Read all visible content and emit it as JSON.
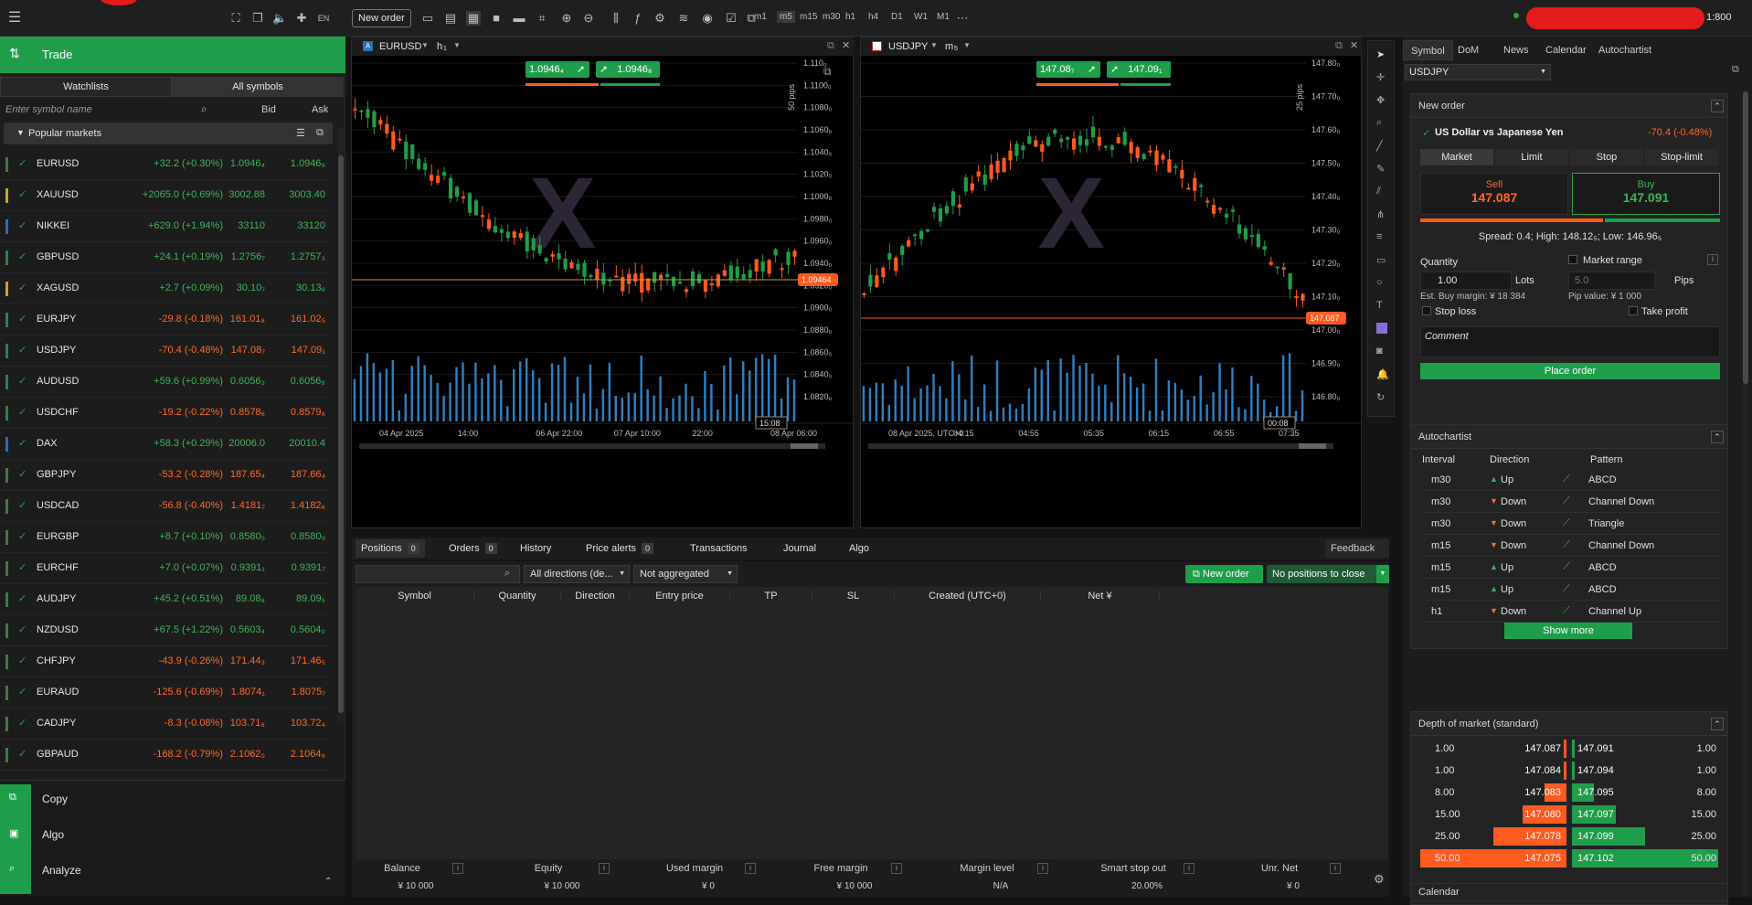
{
  "topbar": {
    "new_order": "New order",
    "timeframes": [
      "m1",
      "m5",
      "m15",
      "m30",
      "h1",
      "h4",
      "D1",
      "W1",
      "M1"
    ],
    "leverage": "1:800"
  },
  "left": {
    "trade_label": "Trade",
    "tabs": [
      "Watchlists",
      "All symbols"
    ],
    "search_placeholder": "Enter symbol name",
    "col_bid": "Bid",
    "col_ask": "Ask",
    "group_label": "Popular markets",
    "rows": [
      {
        "symbol": "EURUSD",
        "change": "+32.2 (+0.30%)",
        "bid": "1.0946₄",
        "ask": "1.0946₈",
        "dir": "up",
        "bar": "#3a7d4a"
      },
      {
        "symbol": "XAUUSD",
        "change": "+2065.0 (+0.69%)",
        "bid": "3002.88",
        "ask": "3003.40",
        "dir": "up",
        "bar": "#c9a227"
      },
      {
        "symbol": "NIKKEI",
        "change": "+629.0 (+1.94%)",
        "bid": "33110",
        "ask": "33120",
        "dir": "up",
        "bar": "#2a6fb6"
      },
      {
        "symbol": "GBPUSD",
        "change": "+24.1 (+0.19%)",
        "bid": "1.2756₇",
        "ask": "1.2757₃",
        "dir": "up",
        "bar": "#3a7d4a"
      },
      {
        "symbol": "XAGUSD",
        "change": "+2.7 (+0.09%)",
        "bid": "30.10₇",
        "ask": "30.13₆",
        "dir": "up",
        "bar": "#c9a227"
      },
      {
        "symbol": "EURJPY",
        "change": "-29.8 (-0.18%)",
        "bid": "161.01₈",
        "ask": "161.02₅",
        "dir": "dn",
        "bar": "#3a7d4a"
      },
      {
        "symbol": "USDJPY",
        "change": "-70.4 (-0.48%)",
        "bid": "147.08₇",
        "ask": "147.09₁",
        "dir": "dn",
        "bar": "#3a7d4a"
      },
      {
        "symbol": "AUDUSD",
        "change": "+59.6 (+0.99%)",
        "bid": "0.6056₃",
        "ask": "0.6056₈",
        "dir": "up",
        "bar": "#3a7d4a"
      },
      {
        "symbol": "USDCHF",
        "change": "-19.2 (-0.22%)",
        "bid": "0.8578₆",
        "ask": "0.8579₆",
        "dir": "dn",
        "bar": "#3a7d4a"
      },
      {
        "symbol": "DAX",
        "change": "+58.3 (+0.29%)",
        "bid": "20006.0",
        "ask": "20010.4",
        "dir": "up",
        "bar": "#2a6fb6"
      },
      {
        "symbol": "GBPJPY",
        "change": "-53.2 (-0.28%)",
        "bid": "187.65₄",
        "ask": "187.66₄",
        "dir": "dn",
        "bar": "#3a7d4a"
      },
      {
        "symbol": "USDCAD",
        "change": "-56.8 (-0.40%)",
        "bid": "1.4181₇",
        "ask": "1.4182₆",
        "dir": "dn",
        "bar": "#3a7d4a"
      },
      {
        "symbol": "EURGBP",
        "change": "+8.7 (+0.10%)",
        "bid": "0.8580₅",
        "ask": "0.8580₉",
        "dir": "up",
        "bar": "#3a7d4a"
      },
      {
        "symbol": "EURCHF",
        "change": "+7.0 (+0.07%)",
        "bid": "0.9391₁",
        "ask": "0.9391₇",
        "dir": "up",
        "bar": "#3a7d4a"
      },
      {
        "symbol": "AUDJPY",
        "change": "+45.2 (+0.51%)",
        "bid": "89.08₈",
        "ask": "89.09₅",
        "dir": "up",
        "bar": "#3a7d4a"
      },
      {
        "symbol": "NZDUSD",
        "change": "+67.5 (+1.22%)",
        "bid": "0.5603₄",
        "ask": "0.5604₀",
        "dir": "up",
        "bar": "#3a7d4a"
      },
      {
        "symbol": "CHFJPY",
        "change": "-43.9 (-0.26%)",
        "bid": "171.44₃",
        "ask": "171.46₅",
        "dir": "dn",
        "bar": "#3a7d4a"
      },
      {
        "symbol": "EURAUD",
        "change": "-125.6 (-0.69%)",
        "bid": "1.8074₁",
        "ask": "1.8075₇",
        "dir": "dn",
        "bar": "#3a7d4a"
      },
      {
        "symbol": "CADJPY",
        "change": "-8.3 (-0.08%)",
        "bid": "103.71₈",
        "ask": "103.72₄",
        "dir": "dn",
        "bar": "#3a7d4a"
      },
      {
        "symbol": "GBPAUD",
        "change": "-168.2 (-0.79%)",
        "bid": "2.1062₀",
        "ask": "2.1064₈",
        "dir": "dn",
        "bar": "#3a7d4a"
      }
    ],
    "bottom_items": [
      "Copy",
      "Algo",
      "Analyze"
    ]
  },
  "chart1": {
    "symbol": "EURUSD",
    "timeframe": "h",
    "timeframe_sub": "1",
    "sell": "1.0946₄",
    "buy": "1.0946₈",
    "pips_label": "50 pips",
    "price_tag": "1.09464",
    "prices": [
      "1.110₀",
      "1.1100₀",
      "1.1080₀",
      "1.1060₀",
      "1.1040₀",
      "1.1020₀",
      "1.1000₀",
      "1.0980₀",
      "1.0960₀",
      "1.0940₀",
      "1.0920₀",
      "1.0900₀",
      "1.0880₀",
      "1.0860₀",
      "1.0840₀",
      "1.0820₀"
    ],
    "times": [
      "04 Apr 2025",
      "14:00",
      "06 Apr 22:00",
      "07 Apr 10:00",
      "22:00",
      "08 Apr 06:00"
    ],
    "countdown": "15:08"
  },
  "chart2": {
    "symbol": "USDJPY",
    "timeframe": "m",
    "timeframe_sub": "5",
    "sell": "147.08₇",
    "buy": "147.09₁",
    "pips_label": "25 pips",
    "price_tag": "147.087",
    "prices": [
      "147.80₀",
      "147.70₀",
      "147.60₀",
      "147.50₀",
      "147.40₀",
      "147.30₀",
      "147.20₀",
      "147.10₀",
      "147.00₀",
      "146.90₀",
      "146.80₀"
    ],
    "times": [
      "08 Apr 2025, UTC+0",
      "04:15",
      "04:55",
      "05:35",
      "06:15",
      "06:55",
      "07:35"
    ],
    "countdown": "00:08"
  },
  "bottom": {
    "tabs": [
      {
        "label": "Positions",
        "count": "0"
      },
      {
        "label": "Orders",
        "count": "0"
      },
      {
        "label": "History",
        "count": ""
      },
      {
        "label": "Price alerts",
        "count": "0"
      },
      {
        "label": "Transactions",
        "count": ""
      },
      {
        "label": "Journal",
        "count": ""
      },
      {
        "label": "Algo",
        "count": ""
      }
    ],
    "feedback": "Feedback",
    "filter_direction": "All directions (de...",
    "filter_agg": "Not aggregated",
    "new_order": "New order",
    "no_positions": "No positions to close",
    "columns": [
      "Symbol",
      "Quantity",
      "Direction",
      "Entry price",
      "TP",
      "SL",
      "Created (UTC+0)",
      "Net ¥"
    ],
    "footer_titles": [
      "Balance",
      "Equity",
      "Used margin",
      "Free margin",
      "Margin level",
      "Smart stop out",
      "Unr. Net"
    ],
    "footer_values": [
      "¥ 10 000",
      "¥ 10 000",
      "¥ 0",
      "¥ 10 000",
      "N/A",
      "20.00%",
      "¥ 0"
    ]
  },
  "right": {
    "tabs": [
      "Symbol",
      "DoM",
      "News",
      "Calendar",
      "Autochartist"
    ],
    "symbol_select": "USDJPY",
    "new_order": {
      "title": "New order",
      "instrument": "US Dollar vs Japanese Yen",
      "change": "-70.4 (-0.48%)",
      "order_types": [
        "Market",
        "Limit",
        "Stop",
        "Stop-limit"
      ],
      "sell_label": "Sell",
      "sell_price": "147.087",
      "buy_label": "Buy",
      "buy_price": "147.091",
      "spread_line": "Spread: 0.4; High: 148.12₅; Low: 146.96₅",
      "quantity_label": "Quantity",
      "market_range": "Market range",
      "quantity_value": "1.00",
      "lots": "Lots",
      "range_value": "5.0",
      "pips": "Pips",
      "margin": "Est. Buy margin: ¥ 18 384",
      "pip_value": "Pip value: ¥ 1 000",
      "stop_loss": "Stop loss",
      "take_profit": "Take profit",
      "comment_placeholder": "Comment",
      "place_order": "Place order"
    },
    "autochartist": {
      "title": "Autochartist",
      "headers": [
        "Interval",
        "Direction",
        "Pattern"
      ],
      "rows": [
        {
          "interval": "m30",
          "direction": "Up",
          "pattern": "ABCD"
        },
        {
          "interval": "m30",
          "direction": "Down",
          "pattern": "Channel Down"
        },
        {
          "interval": "m30",
          "direction": "Down",
          "pattern": "Triangle"
        },
        {
          "interval": "m15",
          "direction": "Down",
          "pattern": "Channel Down"
        },
        {
          "interval": "m15",
          "direction": "Up",
          "pattern": "ABCD"
        },
        {
          "interval": "m15",
          "direction": "Up",
          "pattern": "ABCD"
        },
        {
          "interval": "h1",
          "direction": "Down",
          "pattern": "Channel Up"
        }
      ],
      "show_more": "Show more"
    },
    "dom": {
      "title": "Depth of market (standard)",
      "rows": [
        {
          "bqty": "1.00",
          "bid": "147.087",
          "ask": "147.091",
          "aqty": "1.00",
          "depth": 0.02
        },
        {
          "bqty": "1.00",
          "bid": "147.084",
          "ask": "147.094",
          "aqty": "1.00",
          "depth": 0.02
        },
        {
          "bqty": "8.00",
          "bid": "147.083",
          "ask": "147.095",
          "aqty": "8.00",
          "depth": 0.15
        },
        {
          "bqty": "15.00",
          "bid": "147.080",
          "ask": "147.097",
          "aqty": "15.00",
          "depth": 0.3
        },
        {
          "bqty": "25.00",
          "bid": "147.078",
          "ask": "147.099",
          "aqty": "25.00",
          "depth": 0.5
        },
        {
          "bqty": "50.00",
          "bid": "147.075",
          "ask": "147.102",
          "aqty": "50.00",
          "depth": 1.0
        }
      ]
    },
    "calendar_title": "Calendar"
  },
  "colors": {
    "green": "#1f9e4a",
    "orange": "#ff5a1f",
    "up_text": "#3fb45a",
    "down_text": "#ff6a2b"
  }
}
